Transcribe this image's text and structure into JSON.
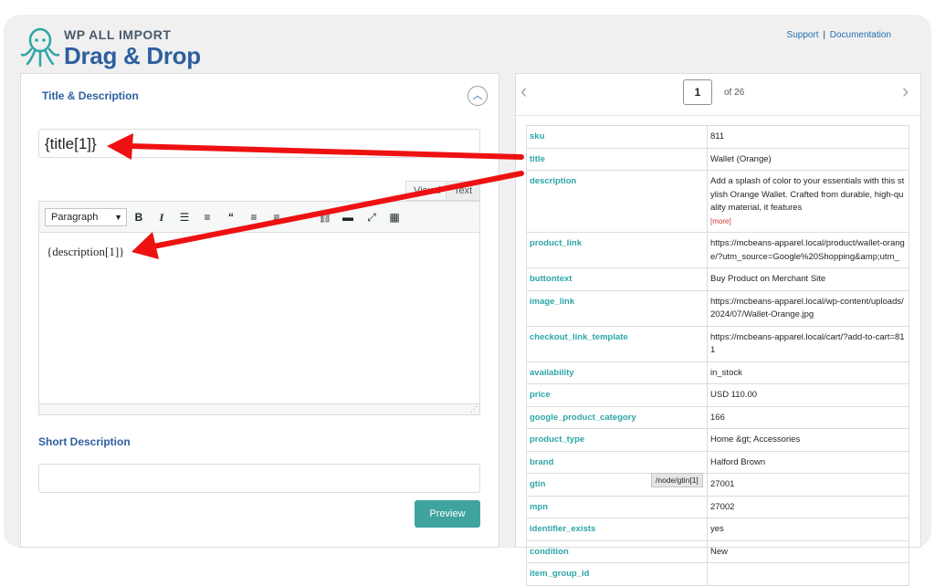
{
  "header": {
    "brand_small": "WP ALL IMPORT",
    "brand_big": "Drag & Drop",
    "support": "Support",
    "separator": "|",
    "documentation": "Documentation"
  },
  "left": {
    "section_title": "Title & Description",
    "title_value": "{title[1]}",
    "tab_visual": "Visual",
    "tab_text": "Text",
    "format_select": "Paragraph",
    "editor_content": "{description[1]}",
    "short_desc_title": "Short Description",
    "preview_label": "Preview"
  },
  "right": {
    "page_current": "1",
    "page_of": "of 26",
    "rows": [
      {
        "key": "sku",
        "value": "811"
      },
      {
        "key": "title",
        "value": "Wallet (Orange)"
      },
      {
        "key": "description",
        "value": "Add a splash of color to your essentials with this stylish Orange Wallet. Crafted from durable, high-quality material, it features",
        "more": "[more]"
      },
      {
        "key": "product_link",
        "value": "https://mcbeans-apparel.local/product/wallet-orange/?utm_source=Google%20Shopping&amp;utm_"
      },
      {
        "key": "buttontext",
        "value": "Buy Product on Merchant Site"
      },
      {
        "key": "image_link",
        "value": "https://mcbeans-apparel.local/wp-content/uploads/2024/07/Wallet-Orange.jpg"
      },
      {
        "key": "checkout_link_template",
        "value": "https://mcbeans-apparel.local/cart/?add-to-cart=811"
      },
      {
        "key": "availability",
        "value": "in_stock"
      },
      {
        "key": "price",
        "value": "USD 110.00"
      },
      {
        "key": "google_product_category",
        "value": "166"
      },
      {
        "key": "product_type",
        "value": "Home &gt; Accessories"
      },
      {
        "key": "brand",
        "value": "Halford Brown"
      },
      {
        "key": "gtin",
        "value": "27001"
      },
      {
        "key": "mpn",
        "value": "27002"
      },
      {
        "key": "identifier_exists",
        "value": "yes"
      },
      {
        "key": "condition",
        "value": "New"
      },
      {
        "key": "item_group_id",
        "value": ""
      }
    ],
    "tooltip": "/node/gtin[1]"
  },
  "colors": {
    "accent_teal": "#40a49e",
    "brand_blue": "#2e5f9e",
    "arrow_red": "#ee1111"
  }
}
